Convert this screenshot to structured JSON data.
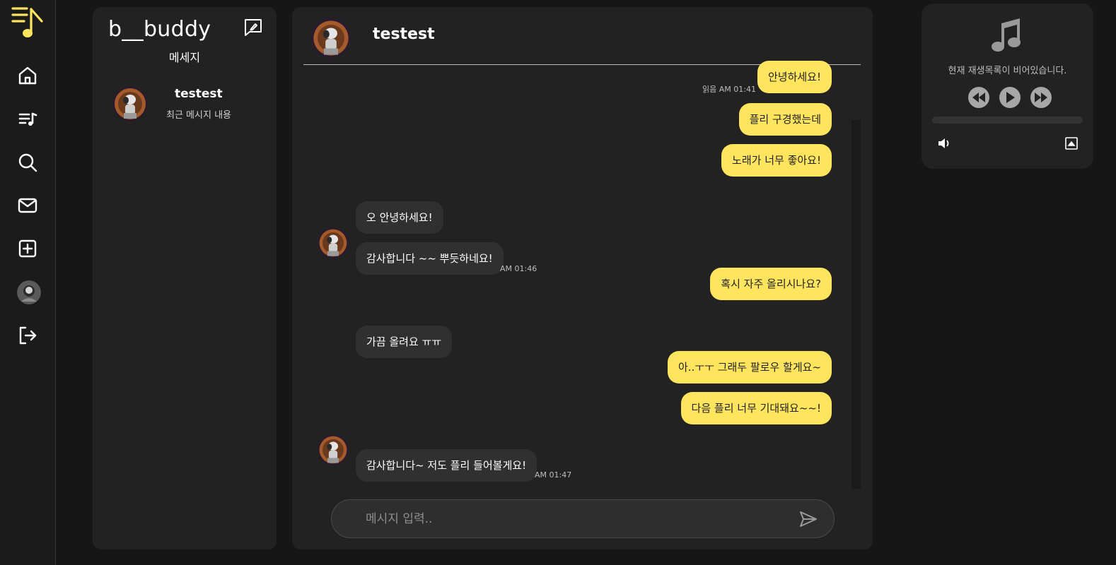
{
  "app": {
    "brand": "b__buddy",
    "section_title": "메세지",
    "accent_color": "#ffe45e"
  },
  "nav": {
    "items": [
      {
        "icon": "home-icon"
      },
      {
        "icon": "playlist-icon"
      },
      {
        "icon": "search-icon"
      },
      {
        "icon": "mail-icon"
      },
      {
        "icon": "add-square-icon"
      },
      {
        "icon": "avatar"
      },
      {
        "icon": "logout-icon"
      }
    ]
  },
  "conversations": [
    {
      "name": "testest",
      "preview": "최근 메시지 내용"
    }
  ],
  "chat": {
    "title": "testest",
    "messages": [
      {
        "from": "me",
        "text": "안녕하세요!",
        "meta": "읽음  AM 01:41"
      },
      {
        "from": "me",
        "text": "플리 구경했는데"
      },
      {
        "from": "me",
        "text": "노래가 너무 좋아요!"
      },
      {
        "from": "them",
        "text": "오 안녕하세요!"
      },
      {
        "from": "them",
        "text": "감사합니다 ~~ 뿌듯하네요!",
        "meta": "AM 01:46"
      },
      {
        "from": "me",
        "text": "혹시 자주 올리시나요?"
      },
      {
        "from": "them",
        "text": "가끔 올려요 ㅠㅠ"
      },
      {
        "from": "me",
        "text": "아..ㅜㅜ 그래두 팔로우 할게요~"
      },
      {
        "from": "me",
        "text": "다음 플리 너무 기대돼요~~!"
      },
      {
        "from": "them",
        "text": "감사합니다~ 저도 플리 들어볼게요!",
        "meta": "AM 01:47"
      }
    ],
    "input_placeholder": "메시지 입력.."
  },
  "player": {
    "empty_text": "현재 재생목록이 비어있습니다.",
    "progress": 0
  }
}
